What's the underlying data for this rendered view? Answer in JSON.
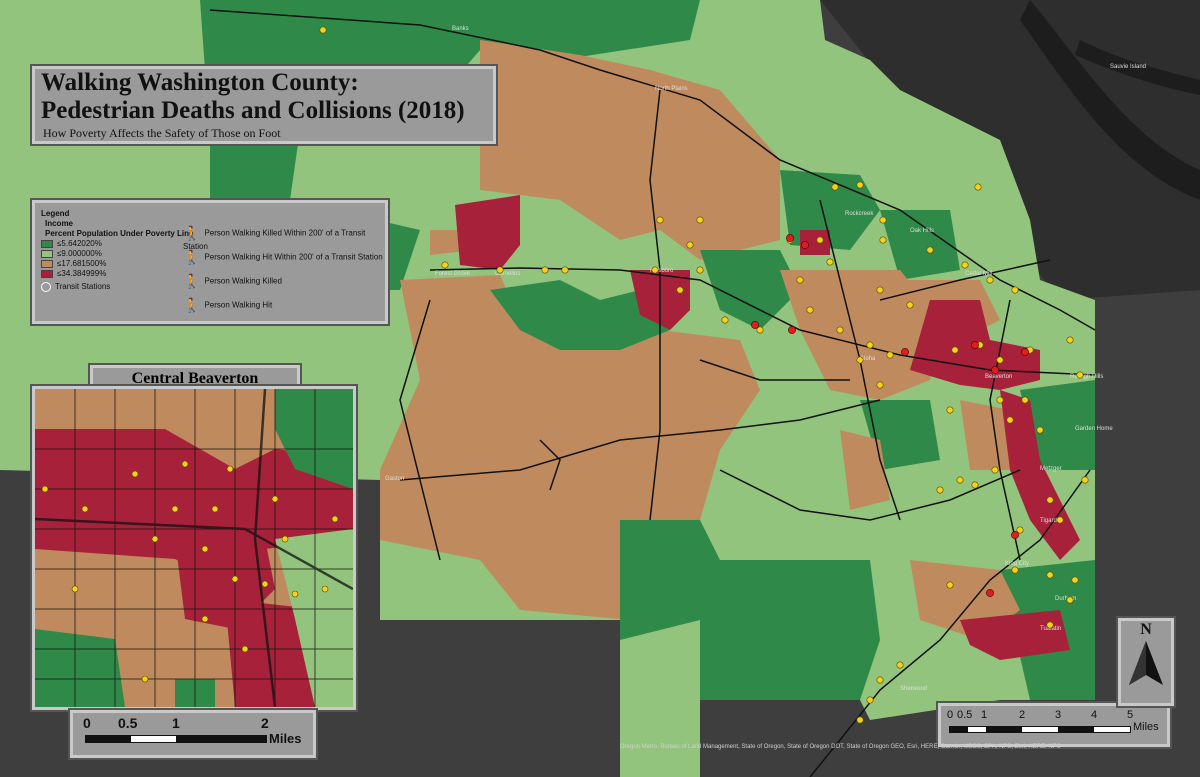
{
  "title": {
    "line1": "Walking Washington County:",
    "line2": "Pedestrian Deaths and Collisions (2018)",
    "subtitle": "How Poverty Affects the Safety of Those on Foot"
  },
  "legend": {
    "heading": "Legend",
    "group": "Income",
    "field": "Percent Population Under Poverty Line",
    "classes": [
      {
        "label": "≤5.642020%",
        "color": "#2f8a4a"
      },
      {
        "label": "≤9.000000%",
        "color": "#93c47d"
      },
      {
        "label": "≤17.681500%",
        "color": "#bf8b5e"
      },
      {
        "label": "≤34.384999%",
        "color": "#a8213a"
      }
    ],
    "transit_label": "Transit Stations",
    "symbols": [
      {
        "label": "Person Walking Killed Within 200' of a Transit Station",
        "icon": "walker-killed-transit-icon",
        "color": "#e11d1d"
      },
      {
        "label": "Person Walking Hit Within 200' of a Transit Station",
        "icon": "walker-hit-transit-icon",
        "color": "#f4d21b"
      },
      {
        "label": "Person Walking Killed",
        "icon": "walker-killed-icon",
        "color": "#e11d1d"
      },
      {
        "label": "Person Walking Hit",
        "icon": "walker-hit-icon",
        "color": "#f4d21b"
      }
    ]
  },
  "inset": {
    "title": "Central Beaverton",
    "scale_labels": [
      "0",
      "0.5",
      "1",
      "2"
    ],
    "scale_unit": "Miles"
  },
  "main_scale": {
    "labels": [
      "0",
      "0.5",
      "1",
      "2",
      "3",
      "4",
      "5"
    ],
    "unit": "Miles"
  },
  "north_arrow": "N",
  "place_names": [
    "Banks",
    "North Plains",
    "Forest Grove",
    "Cornelius",
    "Hillsboro",
    "Aloha",
    "Beaverton",
    "Tigard",
    "Metzger",
    "King City",
    "Durham",
    "Tualatin",
    "Sherwood",
    "Gaston",
    "Rockcreek",
    "Oak Hills",
    "Cedar Mill",
    "Raleigh Hills",
    "Garden Home",
    "Sauvie Island"
  ],
  "credits": "Oregon Metro, Bureau of Land Management, State of Oregon, State of Oregon DOT, State of Oregon GEO, Esri, HERE, Garmin, USGS, EPA, NPS, Esri, HERE, NPS"
}
